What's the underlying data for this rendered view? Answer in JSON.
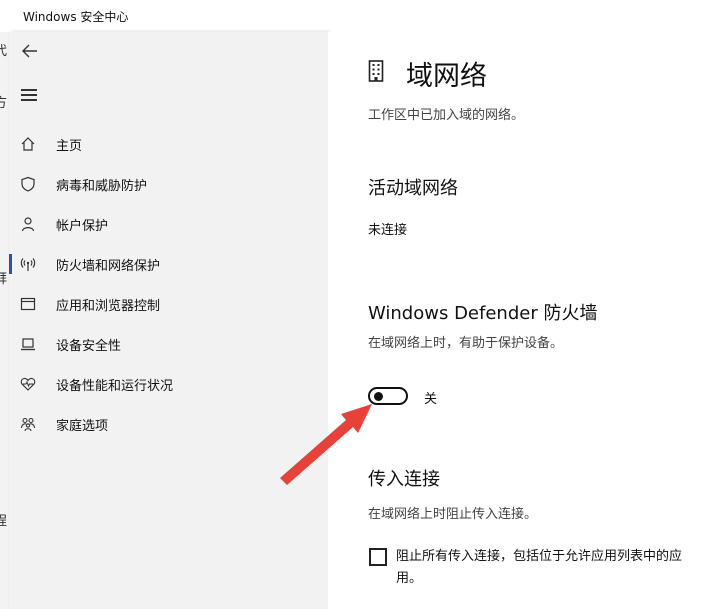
{
  "window": {
    "title": "Windows 安全中心"
  },
  "edge_sliver": {
    "chars": [
      "代",
      "方",
      "拜",
      "程"
    ]
  },
  "sidebar": {
    "items": [
      {
        "label": "主页",
        "icon": "home-icon"
      },
      {
        "label": "病毒和威胁防护",
        "icon": "shield-icon"
      },
      {
        "label": "帐户保护",
        "icon": "person-icon"
      },
      {
        "label": "防火墙和网络保护",
        "icon": "wifi-antenna-icon",
        "active": true
      },
      {
        "label": "应用和浏览器控制",
        "icon": "app-window-icon"
      },
      {
        "label": "设备安全性",
        "icon": "laptop-icon"
      },
      {
        "label": "设备性能和运行状况",
        "icon": "heart-pulse-icon"
      },
      {
        "label": "家庭选项",
        "icon": "family-icon"
      }
    ]
  },
  "main": {
    "page_icon": "building-icon",
    "title": "域网络",
    "description": "工作区中已加入域的网络。",
    "active_networks": {
      "heading": "活动域网络",
      "status": "未连接"
    },
    "firewall": {
      "heading": "Windows Defender 防火墙",
      "description": "在域网络上时，有助于保护设备。",
      "toggle_state": "off",
      "toggle_label": "关"
    },
    "incoming": {
      "heading": "传入连接",
      "description": "在域网络上时阻止传入连接。",
      "checkbox_checked": false,
      "checkbox_label": "阻止所有传入连接，包括位于允许应用列表中的应用。"
    }
  },
  "annotation": {
    "arrow_color": "#e8413a"
  }
}
